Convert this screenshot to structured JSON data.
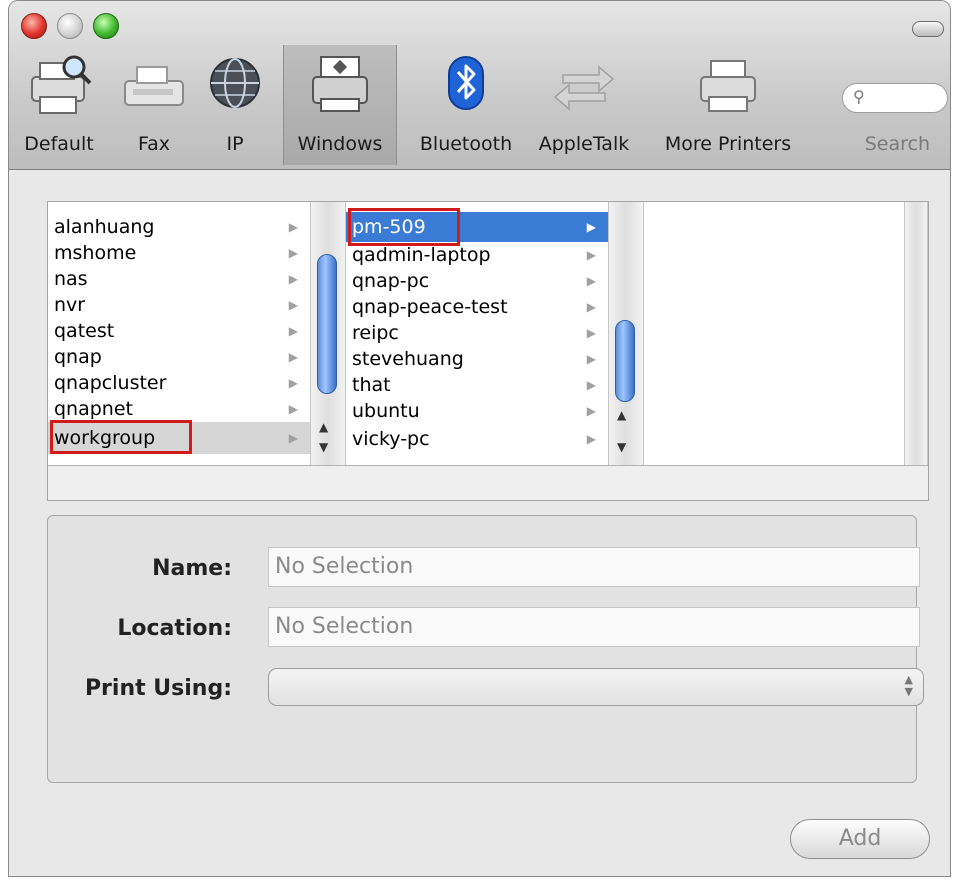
{
  "toolbar": {
    "items": [
      {
        "label": "Default",
        "icon": "printer-magnifier-icon"
      },
      {
        "label": "Fax",
        "icon": "fax-icon"
      },
      {
        "label": "IP",
        "icon": "globe-icon"
      },
      {
        "label": "Windows",
        "icon": "windows-printer-icon"
      },
      {
        "label": "Bluetooth",
        "icon": "bluetooth-icon"
      },
      {
        "label": "AppleTalk",
        "icon": "appletalk-arrows-icon"
      },
      {
        "label": "More Printers",
        "icon": "printer-icon"
      }
    ],
    "selected": "Windows",
    "search_label": "Search"
  },
  "browser": {
    "col1": {
      "items": [
        "alanhuang",
        "mshome",
        "nas",
        "nvr",
        "qatest",
        "qnap",
        "qnapcluster",
        "qnapnet",
        "workgroup"
      ],
      "selected": "workgroup"
    },
    "col2": {
      "items": [
        "pm-509",
        "qadmin-laptop",
        "qnap-pc",
        "qnap-peace-test",
        "reipc",
        "stevehuang",
        "that",
        "ubuntu",
        "vicky-pc"
      ],
      "selected": "pm-509"
    }
  },
  "form": {
    "name_label": "Name:",
    "name_value": "No Selection",
    "location_label": "Location:",
    "location_value": "No Selection",
    "print_using_label": "Print Using:",
    "print_using_value": ""
  },
  "add_label": "Add"
}
